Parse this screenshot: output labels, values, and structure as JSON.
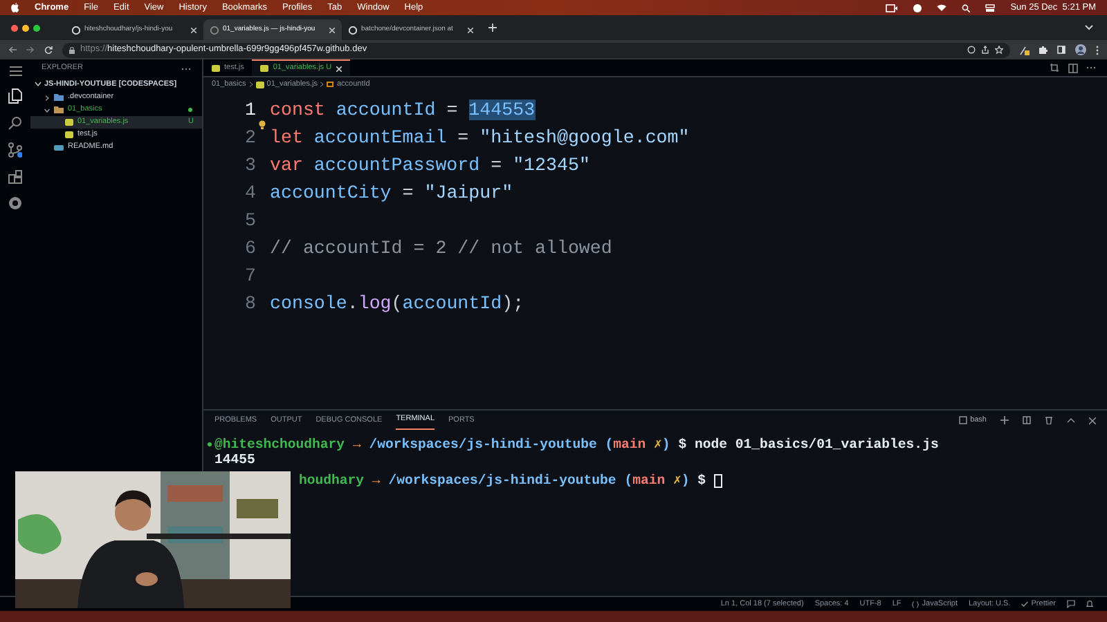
{
  "menubar": {
    "app": "Chrome",
    "items": [
      "File",
      "Edit",
      "View",
      "History",
      "Bookmarks",
      "Profiles",
      "Tab",
      "Window",
      "Help"
    ],
    "clock": "Sun 25 Dec  5:21 PM"
  },
  "browser_tabs": [
    {
      "title": "hiteshchoudhary/js-hindi-you",
      "selected": false
    },
    {
      "title": "01_variables.js — js-hindi-you",
      "selected": true
    },
    {
      "title": "batchone/devcontainer.json at",
      "selected": false
    }
  ],
  "address_bar": {
    "scheme": "https://",
    "host": "hiteshchoudhary-opulent-umbrella-699r9gg496pf457w.github.dev"
  },
  "explorer": {
    "title": "EXPLORER",
    "root": "JS-HINDI-YOUTUBE [CODESPACES]",
    "items": [
      {
        "label": ".devcontainer",
        "kind": "folder",
        "expanded": false,
        "selected": false
      },
      {
        "label": "01_basics",
        "kind": "folder",
        "expanded": true,
        "selected": false,
        "children": [
          {
            "label": "01_variables.js",
            "kind": "js",
            "selected": true,
            "badge": "U"
          },
          {
            "label": "test.js",
            "kind": "js",
            "selected": false
          }
        ]
      },
      {
        "label": "README.md",
        "kind": "md",
        "selected": false
      }
    ]
  },
  "editor_tabs": [
    {
      "label": "test.js",
      "selected": false
    },
    {
      "label": "01_variables.js",
      "selected": true,
      "badge": "U"
    }
  ],
  "breadcrumb": [
    "01_basics",
    "01_variables.js",
    "accountId"
  ],
  "code": [
    {
      "number": "1",
      "tokens": [
        {
          "text": "const ",
          "kind": "keyword"
        },
        {
          "text": "accountId",
          "kind": "variable"
        },
        {
          "text": " = ",
          "kind": "plain"
        },
        {
          "text": "144553",
          "kind": "variable",
          "selected": true
        }
      ]
    },
    {
      "number": "2",
      "tokens": [
        {
          "text": "let ",
          "kind": "keyword"
        },
        {
          "text": "accountEmail",
          "kind": "variable"
        },
        {
          "text": " = ",
          "kind": "plain"
        },
        {
          "text": "\"hitesh@google.com\"",
          "kind": "string"
        }
      ]
    },
    {
      "number": "3",
      "tokens": [
        {
          "text": "var ",
          "kind": "keyword"
        },
        {
          "text": "accountPassword",
          "kind": "variable"
        },
        {
          "text": " = ",
          "kind": "plain"
        },
        {
          "text": "\"12345\"",
          "kind": "string"
        }
      ]
    },
    {
      "number": "4",
      "tokens": [
        {
          "text": "accountCity",
          "kind": "variable"
        },
        {
          "text": " = ",
          "kind": "plain"
        },
        {
          "text": "\"Jaipur\"",
          "kind": "string"
        }
      ]
    },
    {
      "number": "5"
    },
    {
      "number": "6",
      "tokens": [
        {
          "text": "// accountId = 2 // not allowed",
          "kind": "comment"
        }
      ]
    },
    {
      "number": "7"
    },
    {
      "number": "8",
      "tokens": [
        {
          "text": "console",
          "kind": "variable"
        },
        {
          "text": ".",
          "kind": "plain"
        },
        {
          "text": "log",
          "kind": "function"
        },
        {
          "text": "(",
          "kind": "plain"
        },
        {
          "text": "accountId",
          "kind": "variable"
        },
        {
          "text": ");",
          "kind": "plain"
        }
      ]
    }
  ],
  "panel_tabs": [
    {
      "label": "PROBLEMS",
      "selected": false
    },
    {
      "label": "OUTPUT",
      "selected": false
    },
    {
      "label": "DEBUG CONSOLE",
      "selected": false
    },
    {
      "label": "TERMINAL",
      "selected": true
    },
    {
      "label": "PORTS",
      "selected": false
    }
  ],
  "shell": "bash",
  "terminal": [
    {
      "kind": "prompt",
      "tokens": [
        {
          "text": "@hiteshchoudhary",
          "kind": "user"
        },
        {
          "text": " → ",
          "kind": "arrow"
        },
        {
          "text": "/workspaces/js-hindi-youtube",
          "kind": "path"
        },
        {
          "text": " (",
          "kind": "paren"
        },
        {
          "text": "main",
          "kind": "branch"
        },
        {
          "text": " ✗",
          "kind": "dirty"
        },
        {
          "text": ")",
          "kind": "paren"
        },
        {
          "text": " $ node 01_basics/01_variables.js",
          "kind": "plain"
        }
      ]
    },
    {
      "kind": "output",
      "tokens": [
        {
          "text": "14455",
          "kind": "plain"
        }
      ]
    },
    {
      "kind": "prompt_cut",
      "tokens": [
        {
          "text": "houdhary",
          "kind": "user"
        },
        {
          "text": " → ",
          "kind": "arrow"
        },
        {
          "text": "/workspaces/js-hindi-youtube",
          "kind": "path"
        },
        {
          "text": " (",
          "kind": "paren"
        },
        {
          "text": "main",
          "kind": "branch"
        },
        {
          "text": " ✗",
          "kind": "dirty"
        },
        {
          "text": ")",
          "kind": "paren"
        },
        {
          "text": " $",
          "kind": "plain"
        }
      ],
      "cursor": true
    }
  ],
  "webcam": {
    "kind": "picture"
  },
  "status_bar": [
    "Ln 1, Col 18 (7 selected)",
    "Spaces: 4",
    "UTF-8",
    "LF",
    "JavaScript",
    "Layout: U.S.",
    "Prettier"
  ]
}
